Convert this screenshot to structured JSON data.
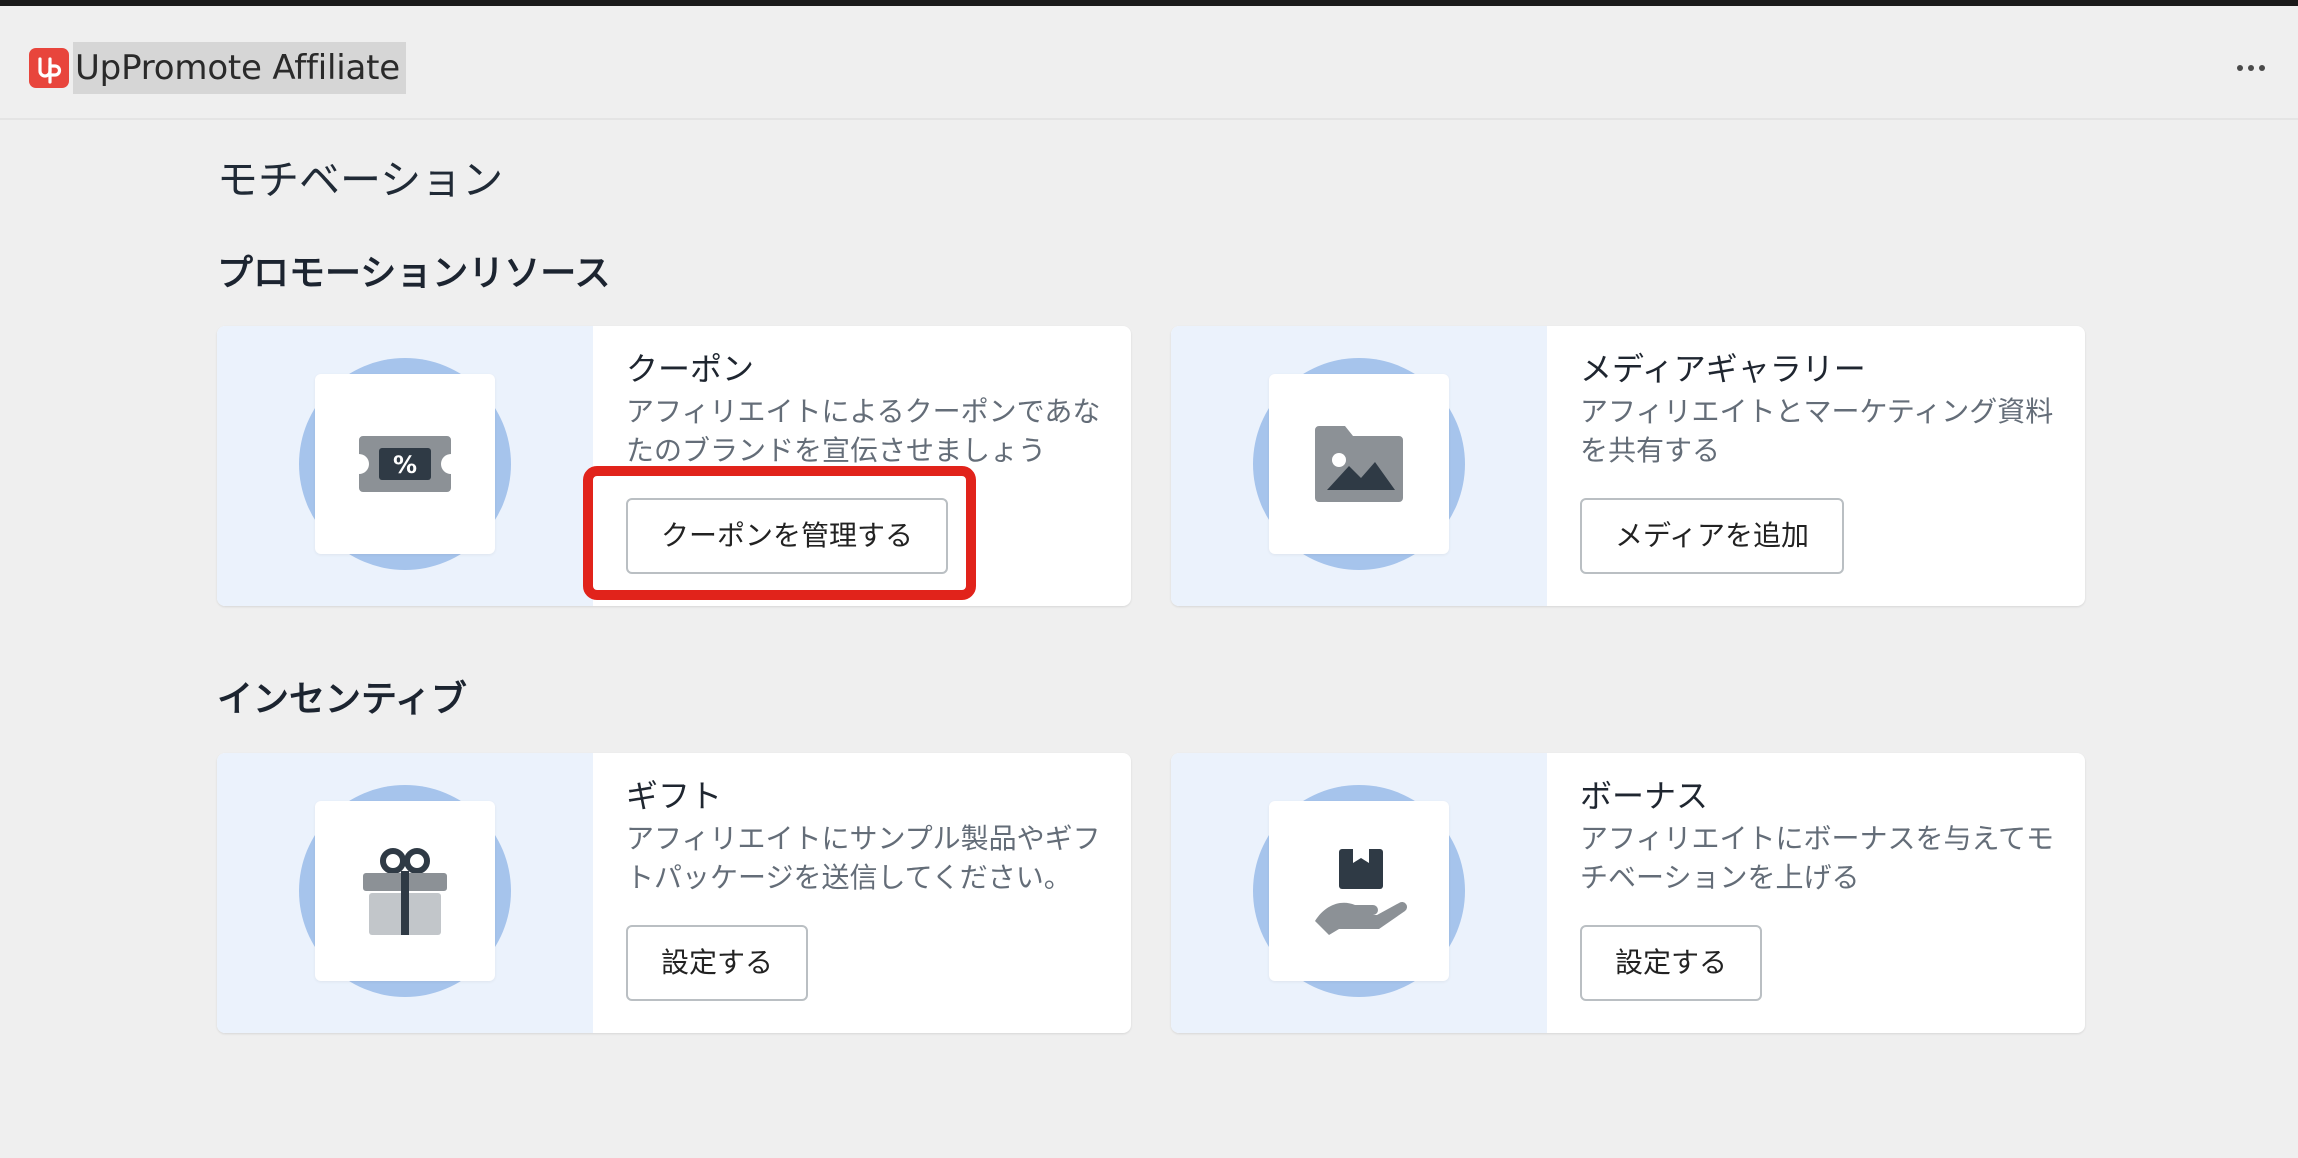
{
  "app": {
    "title": "UpPromote Affiliate",
    "logo_icon": "uppromote-logo-icon",
    "accent_color": "#e8453c",
    "more_icon": "more-horizontal-icon"
  },
  "page": {
    "title": "モチベーション"
  },
  "sections": [
    {
      "title": "プロモーションリソース",
      "cards": [
        {
          "title": "クーポン",
          "description": "アフィリエイトによるクーポンであなたのブランドを宣伝させましょう",
          "button": "クーポンを管理する",
          "icon": "coupon-icon"
        },
        {
          "title": "メディアギャラリー",
          "description": "アフィリエイトとマーケティング資料を共有する",
          "button": "メディアを追加",
          "icon": "image-folder-icon"
        }
      ]
    },
    {
      "title": "インセンティブ",
      "cards": [
        {
          "title": "ギフト",
          "description": "アフィリエイトにサンプル製品やギフトパッケージを送信してください。",
          "button": "設定する",
          "icon": "gift-icon"
        },
        {
          "title": "ボーナス",
          "description": "アフィリエイトにボーナスを与えてモチベーションを上げる",
          "button": "設定する",
          "icon": "bonus-hand-box-icon"
        }
      ]
    }
  ],
  "highlight_color": "#e1231b"
}
